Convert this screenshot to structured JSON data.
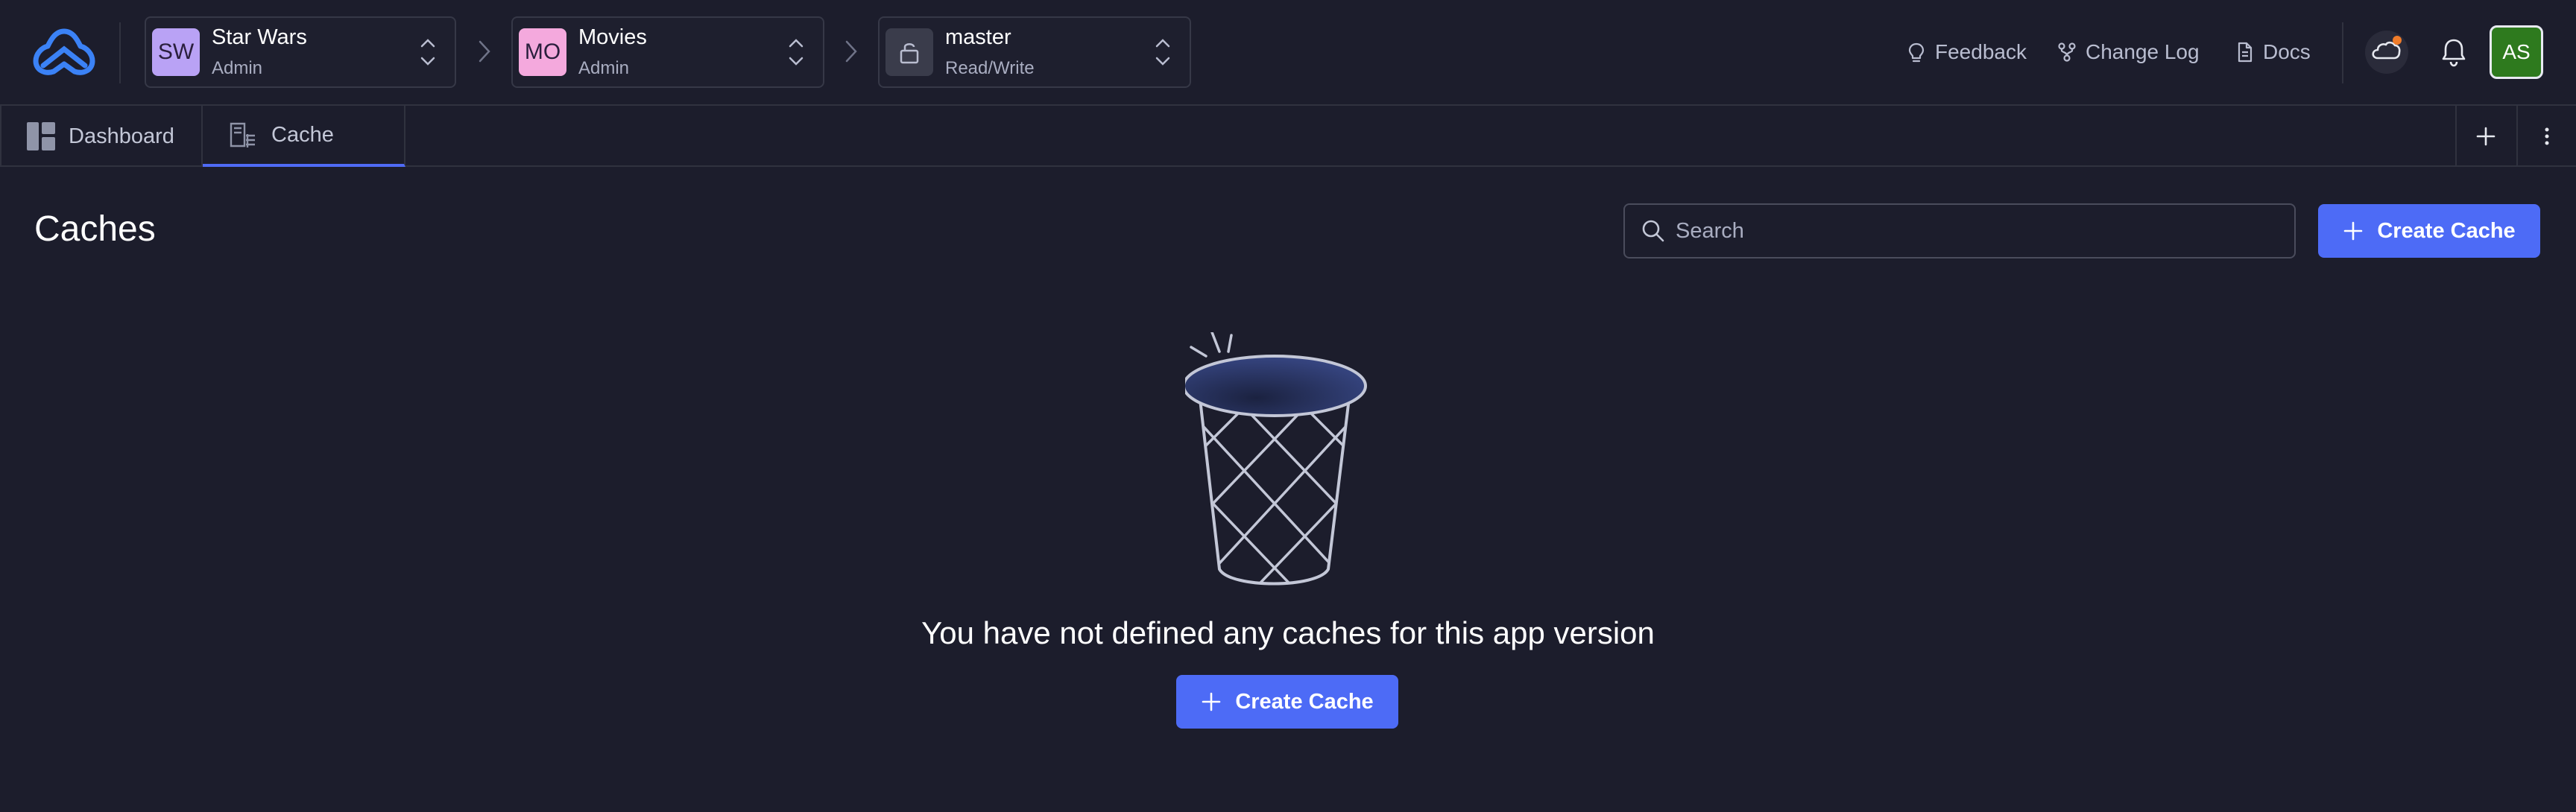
{
  "header": {
    "org": {
      "initials": "SW",
      "name": "Star Wars",
      "role": "Admin",
      "color": "#b9a2f5"
    },
    "app": {
      "initials": "MO",
      "name": "Movies",
      "role": "Admin",
      "color": "#f4a9dd"
    },
    "branch": {
      "name": "master",
      "access": "Read/Write"
    },
    "links": {
      "feedback": "Feedback",
      "changelog": "Change Log",
      "docs": "Docs"
    },
    "user_initials": "AS",
    "icons": [
      "logo-icon",
      "lightbulb-icon",
      "changelog-icon",
      "document-icon",
      "cloud-icon",
      "bell-icon",
      "lock-icon"
    ]
  },
  "tabs": [
    {
      "label": "Dashboard",
      "icon": "dashboard-icon",
      "active": false
    },
    {
      "label": "Cache",
      "icon": "cache-icon",
      "active": true
    }
  ],
  "main": {
    "title": "Caches",
    "search_placeholder": "Search",
    "create_label": "Create Cache",
    "empty_message": "You have not defined any caches for this app version"
  },
  "colors": {
    "accent": "#4d6bf6",
    "background": "#1c1d2c",
    "notification_dot": "#f07c2a"
  }
}
